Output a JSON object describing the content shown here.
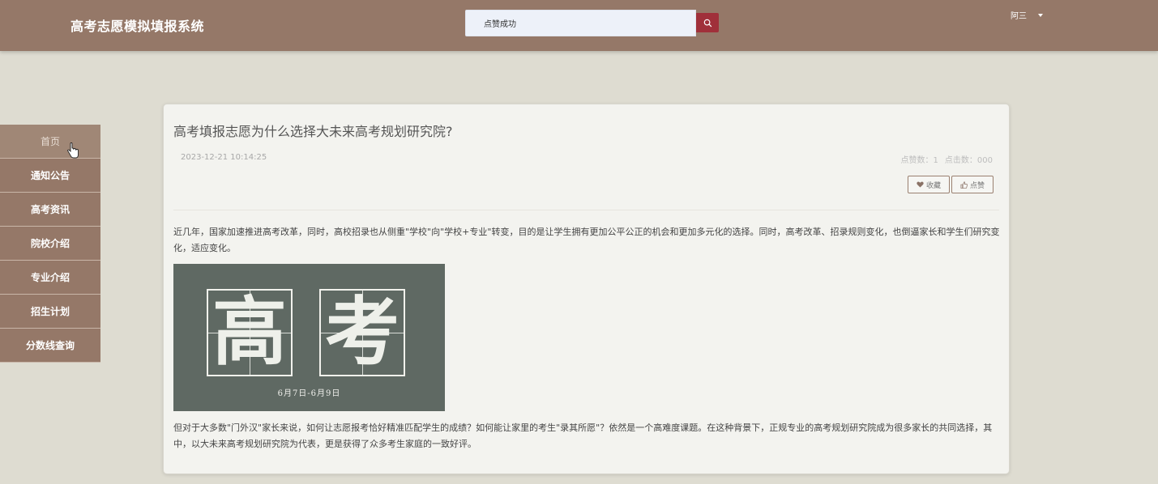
{
  "header": {
    "title": "高考志愿模拟填报系统",
    "search_value": "点赞成功",
    "user_name": "阿三"
  },
  "sidebar": {
    "items": [
      {
        "label": "首页",
        "active": true
      },
      {
        "label": "通知公告"
      },
      {
        "label": "高考资讯"
      },
      {
        "label": "院校介绍"
      },
      {
        "label": "专业介绍"
      },
      {
        "label": "招生计划"
      },
      {
        "label": "分数线查询"
      }
    ]
  },
  "article": {
    "title": "高考填报志愿为什么选择大未来高考规划研究院?",
    "date": "2023-12-21 10:14:25",
    "likes_label": "点赞数：1",
    "clicks_label": "点击数：000",
    "favorite_label": "收藏",
    "like_label": "点赞",
    "para1": "近几年，国家加速推进高考改革，同时，高校招录也从侧重\"学校\"向\"学校+专业\"转变，目的是让学生拥有更加公平公正的机会和更加多元化的选择。同时，高考改革、招录规则变化，也倒逼家长和学生们研究变化，适应变化。",
    "image": {
      "char1": "高",
      "char2": "考",
      "date_text": "6月7日-6月9日"
    },
    "para2": "但对于大多数\"门外汉\"家长来说，如何让志愿报考恰好精准匹配学生的成绩？如何能让家里的考生\"录其所愿\"？依然是一个高难度课题。在这种背景下，正规专业的高考规划研究院成为很多家长的共同选择，其中，以大未来高考规划研究院为代表，更是获得了众多考生家庭的一致好评。"
  },
  "colors": {
    "header_bg": "#957868",
    "page_bg": "#dedcd1",
    "search_button": "#a0303a"
  }
}
